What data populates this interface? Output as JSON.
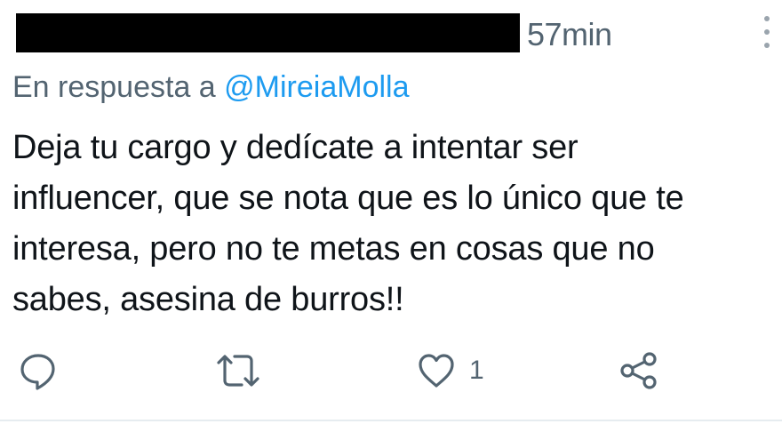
{
  "header": {
    "timestamp": "57min",
    "more_icon": "vertical-ellipsis-icon"
  },
  "reply": {
    "prefix": "En respuesta a ",
    "mention": "@MireiaMolla"
  },
  "tweet": {
    "lines": [
      "Deja tu cargo y dedícate a intentar ser",
      "influencer, que se nota que es lo único que te",
      "interesa, pero no te metas en cosas que no",
      "sabes, asesina de burros!!"
    ]
  },
  "actions": {
    "reply_icon": "reply-icon",
    "retweet_icon": "retweet-icon",
    "like_icon": "heart-icon",
    "like_count": "1",
    "share_icon": "share-icon"
  },
  "colors": {
    "text": "#0f1419",
    "secondary": "#536471",
    "accent": "#1d9bf0",
    "divider": "#e6ecf0"
  }
}
